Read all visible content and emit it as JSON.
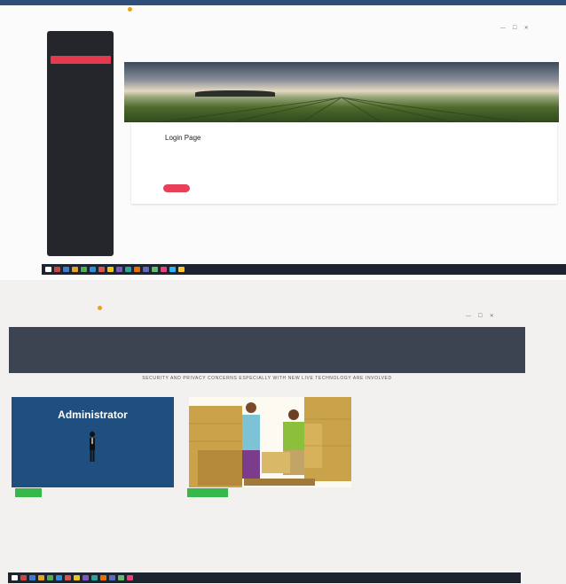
{
  "screen1": {
    "browser_tab": "",
    "window_controls": "— ☐ ✕",
    "sidebar": {
      "brand": "",
      "items": [
        "",
        "",
        "",
        "",
        "",
        "",
        "",
        "",
        "",
        "",
        ""
      ]
    },
    "breadcrumb": "",
    "breadcrumb_sub": "",
    "card": {
      "title": "Login Page",
      "button_label": "",
      "link_label": ""
    }
  },
  "screen2": {
    "browser_tab": "",
    "window_controls": "— ☐ ✕",
    "hero": {
      "title": "",
      "subtitle": ""
    },
    "tagline": "SECURITY AND PRIVACY CONCERNS ESPECIALLY WITH NEW LIVE TECHNOLOGY ARE INVOLVED",
    "admin_section": {
      "label": "",
      "card_text": "Administrator",
      "button_label": ""
    },
    "farmer_section": {
      "label": "",
      "button_label": "",
      "caption": ""
    }
  },
  "taskbar": {
    "tray_time": ""
  },
  "colors": {
    "sidebar_bg": "#24262b",
    "accent_red": "#e5394f",
    "hero_bg": "#3c4452",
    "admin_bg": "#1f4f7e",
    "button_green": "#36b84a",
    "taskbar_bg": "#1d2430"
  }
}
